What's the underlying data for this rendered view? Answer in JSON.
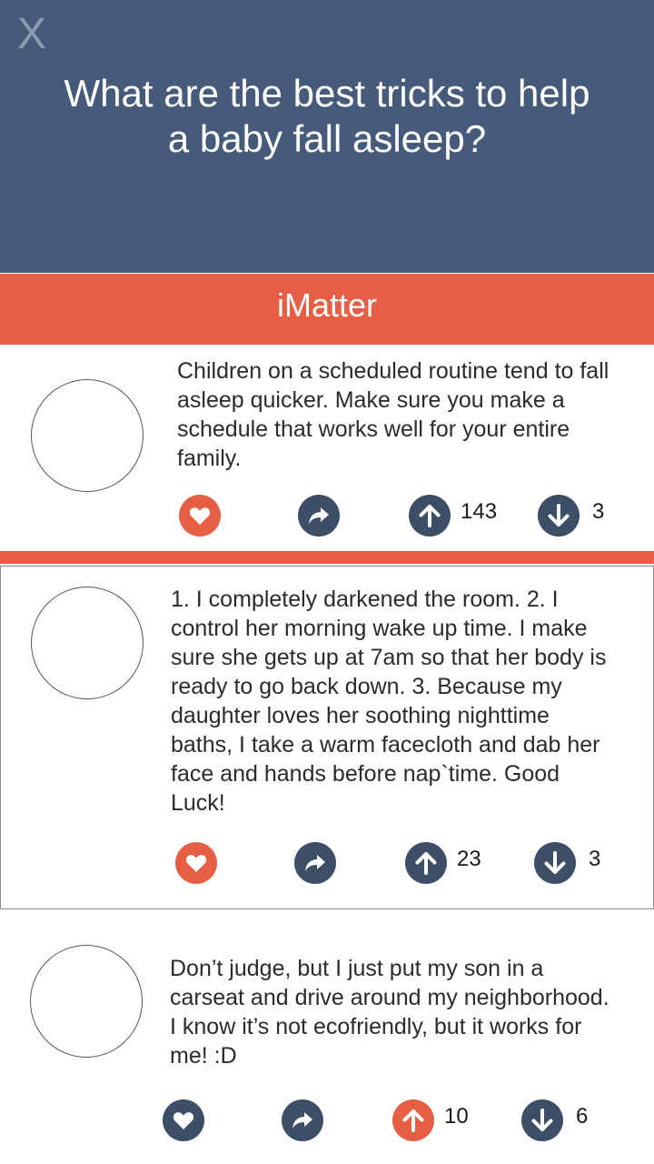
{
  "header": {
    "close_label": "X",
    "question": "What are the best tricks to help a baby fall asleep?"
  },
  "brand": {
    "name": "iMatter"
  },
  "colors": {
    "header_bg": "#465a79",
    "accent": "#e65f44",
    "icon_navy": "#3c4f66"
  },
  "answers": [
    {
      "text": "Children on a scheduled routine tend to fall asleep quicker.  Make sure you make a schedule that works well for your entire family.",
      "upvotes": "143",
      "downvotes": "3",
      "liked": true,
      "upvoted": false
    },
    {
      "text": "1. I completely darkened the room. 2. I control her morning wake up time. I make sure she gets up at 7am so that her body is ready to go back down. 3. Because my daughter loves her soothing nighttime baths, I take a warm facecloth and dab her face and hands before nap`time. Good Luck!",
      "upvotes": "23",
      "downvotes": "3",
      "liked": true,
      "upvoted": false
    },
    {
      "text": "Don’t judge, but I just put my son in a carseat and drive around my neighborhood.  I know it’s not ecofriendly, but it works for me! :D",
      "upvotes": "10",
      "downvotes": "6",
      "liked": false,
      "upvoted": true
    }
  ],
  "icons": {
    "close": "close-icon",
    "like": "heart-icon",
    "share": "share-arrow-icon",
    "upvote": "arrow-up-icon",
    "downvote": "arrow-down-icon"
  }
}
